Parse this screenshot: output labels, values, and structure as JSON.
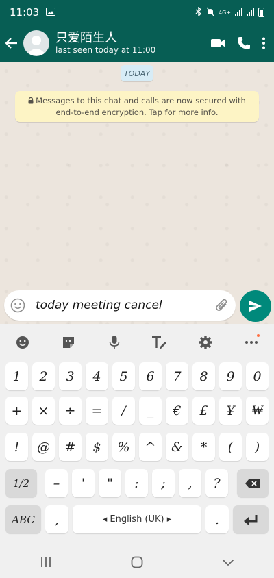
{
  "status_bar": {
    "time": "11:03",
    "network": "4G+"
  },
  "header": {
    "contact_name": "只爱陌生人",
    "last_seen": "last seen today at 11:00"
  },
  "chat": {
    "date_chip": "TODAY",
    "encryption_notice": "Messages to this chat and calls are now secured with end-to-end encryption. Tap for more info."
  },
  "compose": {
    "message_text": "today meeting cancel"
  },
  "keyboard": {
    "row1": [
      "1",
      "2",
      "3",
      "4",
      "5",
      "6",
      "7",
      "8",
      "9",
      "0"
    ],
    "row2": [
      "+",
      "×",
      "÷",
      "=",
      "/",
      "_",
      "€",
      "£",
      "¥",
      "₩"
    ],
    "row3": [
      "!",
      "@",
      "#",
      "$",
      "%",
      "^",
      "&",
      "*",
      "(",
      ")"
    ],
    "row4": [
      "1/2",
      "–",
      "'",
      "\"",
      ":",
      ";",
      ",",
      "?"
    ],
    "abc_label": "ABC",
    "comma_label": ",",
    "space_label": "◂ English (UK) ▸",
    "period_label": "."
  }
}
